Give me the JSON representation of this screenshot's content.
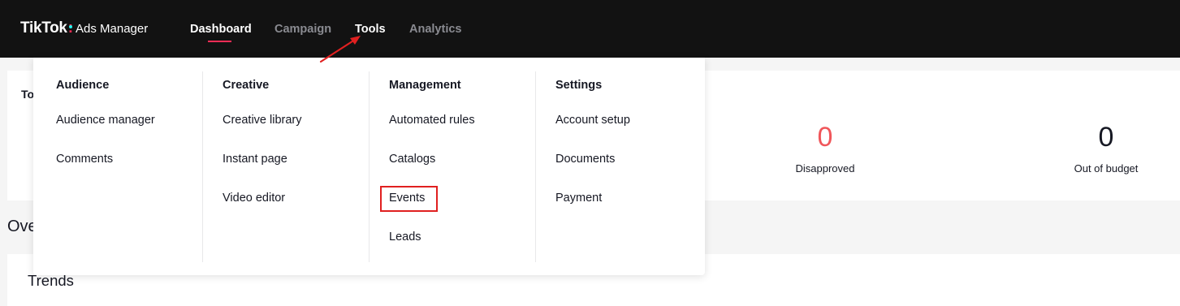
{
  "app": {
    "brand_name": "TikTok",
    "brand_sub": "Ads Manager"
  },
  "nav": {
    "dashboard": "Dashboard",
    "campaign": "Campaign",
    "tools": "Tools",
    "analytics": "Analytics"
  },
  "status": {
    "heading_partial": "To",
    "disapproved_value": "0",
    "disapproved_label": "Disapproved",
    "budget_value": "0",
    "budget_label": "Out of budget"
  },
  "overview": {
    "title_partial": "Ove",
    "trends_title": "Trends"
  },
  "tools_menu": {
    "columns": [
      {
        "heading": "Audience",
        "items": [
          "Audience manager",
          "Comments"
        ]
      },
      {
        "heading": "Creative",
        "items": [
          "Creative library",
          "Instant page",
          "Video editor"
        ]
      },
      {
        "heading": "Management",
        "items": [
          "Automated rules",
          "Catalogs",
          "Events",
          "Leads"
        ]
      },
      {
        "heading": "Settings",
        "items": [
          "Account setup",
          "Documents",
          "Payment"
        ]
      }
    ]
  },
  "colors": {
    "topbar": "#121212",
    "accent": "#fe2c55",
    "disapproved": "#f0565a",
    "annotation": "#e02020"
  },
  "icons": {
    "annotation_arrow": "red-arrow-icon"
  }
}
